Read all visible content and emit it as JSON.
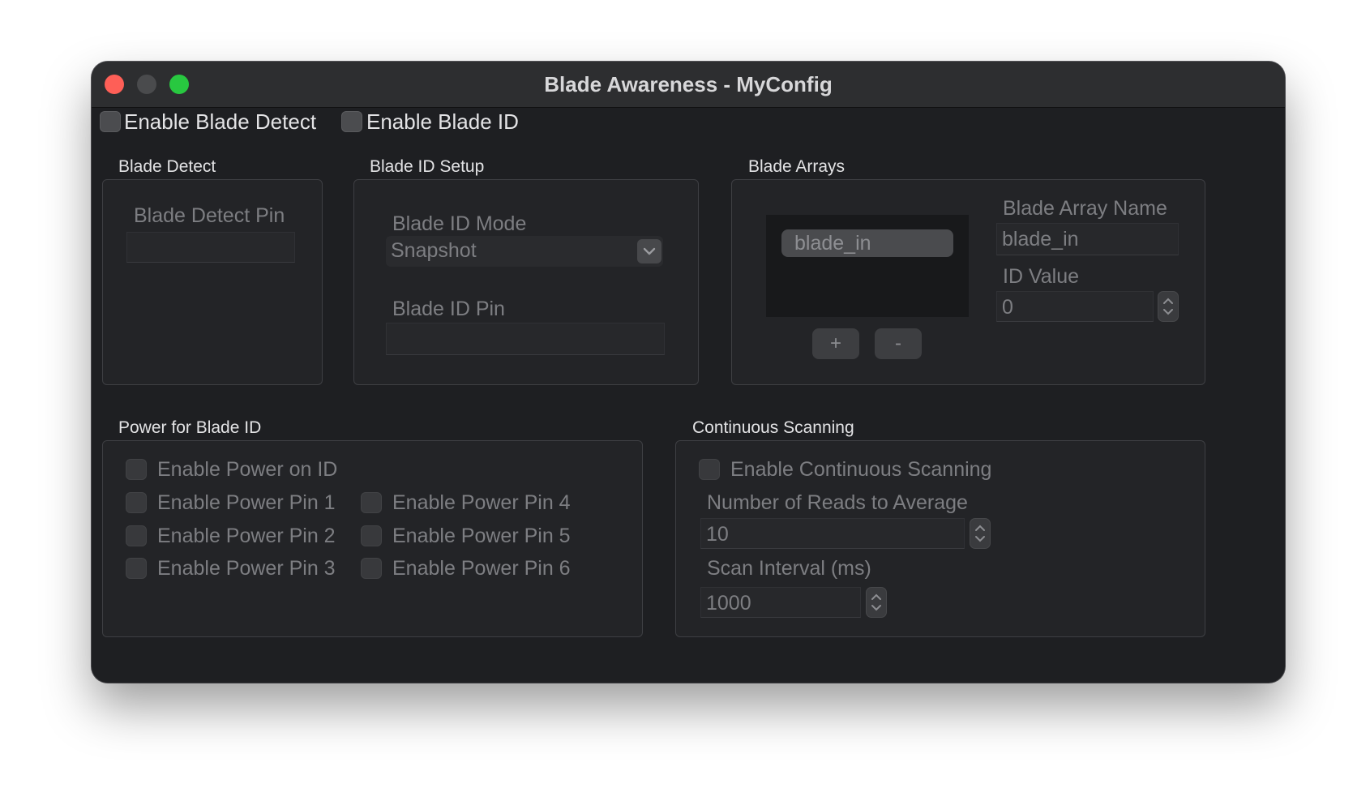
{
  "window": {
    "title": "Blade Awareness - MyConfig",
    "accent_close": "#fe5f57",
    "accent_max": "#28c840"
  },
  "top": {
    "enable_blade_detect": "Enable Blade Detect",
    "enable_blade_id": "Enable Blade ID"
  },
  "blade_detect": {
    "group_title": "Blade Detect",
    "pin_label": "Blade Detect Pin",
    "pin_value": ""
  },
  "blade_id_setup": {
    "group_title": "Blade ID Setup",
    "mode_label": "Blade ID Mode",
    "mode_value": "Snapshot",
    "pin_label": "Blade ID Pin",
    "pin_value": ""
  },
  "blade_arrays": {
    "group_title": "Blade Arrays",
    "items": [
      "blade_in"
    ],
    "add_label": "+",
    "remove_label": "-",
    "name_label": "Blade Array Name",
    "name_value": "blade_in",
    "id_label": "ID Value",
    "id_value": "0"
  },
  "power": {
    "group_title": "Power for Blade ID",
    "enable_power_on_id": "Enable Power on ID",
    "pins": [
      "Enable Power Pin 1",
      "Enable Power Pin 2",
      "Enable Power Pin 3",
      "Enable Power Pin 4",
      "Enable Power Pin 5",
      "Enable Power Pin 6"
    ]
  },
  "scanning": {
    "group_title": "Continuous Scanning",
    "enable_label": "Enable Continuous Scanning",
    "reads_label": "Number of Reads to Average",
    "reads_value": "10",
    "interval_label": "Scan Interval (ms)",
    "interval_value": "1000"
  }
}
